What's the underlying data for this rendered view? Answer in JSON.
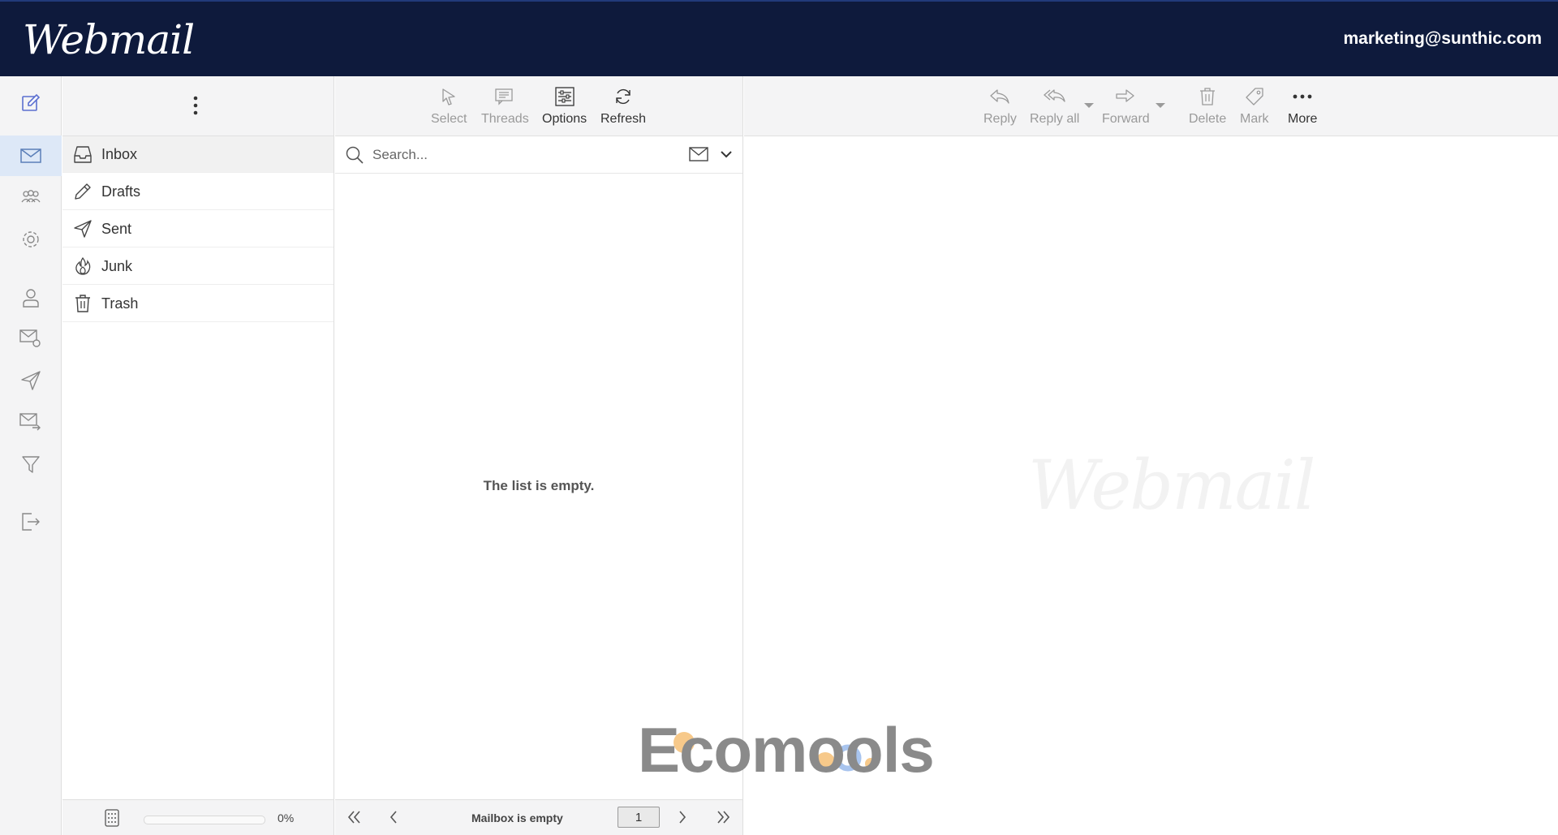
{
  "header": {
    "logo": "Webmail",
    "user_email": "marketing@sunthic.com"
  },
  "rail": {
    "items": [
      {
        "icon": "compose-icon",
        "active": false
      },
      {
        "icon": "mail-icon",
        "active": true
      },
      {
        "icon": "contacts-icon",
        "active": false
      },
      {
        "icon": "settings-icon",
        "active": false
      },
      {
        "icon": "user-icon",
        "active": false
      },
      {
        "icon": "mail-settings-icon",
        "active": false
      },
      {
        "icon": "send-icon",
        "active": false
      },
      {
        "icon": "forward-mail-icon",
        "active": false
      },
      {
        "icon": "filter-icon",
        "active": false
      },
      {
        "icon": "logout-icon",
        "active": false
      }
    ]
  },
  "folders": {
    "items": [
      {
        "label": "Inbox",
        "icon": "inbox-icon",
        "active": true
      },
      {
        "label": "Drafts",
        "icon": "pencil-icon",
        "active": false
      },
      {
        "label": "Sent",
        "icon": "send-icon",
        "active": false
      },
      {
        "label": "Junk",
        "icon": "fire-icon",
        "active": false
      },
      {
        "label": "Trash",
        "icon": "trash-icon",
        "active": false
      }
    ],
    "quota": {
      "percent_label": "0%",
      "fraction": 0
    }
  },
  "list": {
    "toolbar": {
      "select": "Select",
      "threads": "Threads",
      "options": "Options",
      "refresh": "Refresh"
    },
    "search": {
      "placeholder": "Search..."
    },
    "empty_message": "The list is empty.",
    "footer": {
      "status": "Mailbox is empty",
      "page": "1"
    }
  },
  "preview": {
    "toolbar": {
      "reply": "Reply",
      "reply_all": "Reply all",
      "forward": "Forward",
      "delete": "Delete",
      "mark": "Mark",
      "more": "More"
    },
    "watermark": "Webmail"
  },
  "brand_overlay": {
    "text": "Ecomools",
    "colors": {
      "accent_orange": "#f7c98a",
      "accent_blue": "#a8c4ee"
    }
  },
  "colors": {
    "header_bg": "#0e1a3c",
    "active_rail": "#dde8f7",
    "panel_bg": "#f4f4f5"
  }
}
